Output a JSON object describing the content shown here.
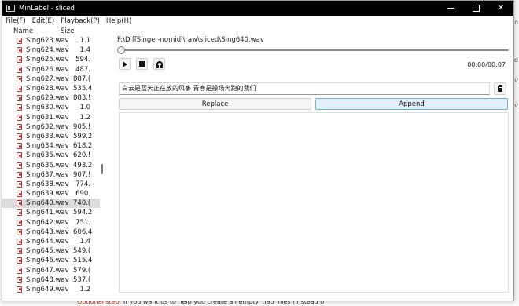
{
  "window": {
    "title": "MinLabel - sliced",
    "controls": [
      "minimize-icon",
      "maximize-icon",
      "close-icon"
    ]
  },
  "menu": [
    {
      "label": "File(F)"
    },
    {
      "label": "Edit(E)"
    },
    {
      "label": "Playback(P)"
    },
    {
      "label": "Help(H)"
    }
  ],
  "filelist": {
    "headers": {
      "name": "Name",
      "size": "Size"
    },
    "selected_index": 17,
    "rows": [
      {
        "name": "Sing623.wav",
        "size": "1.1"
      },
      {
        "name": "Sing624.wav",
        "size": "1.4"
      },
      {
        "name": "Sing625.wav",
        "size": "594."
      },
      {
        "name": "Sing626.wav",
        "size": "487."
      },
      {
        "name": "Sing627.wav",
        "size": "887.("
      },
      {
        "name": "Sing628.wav",
        "size": "535.4"
      },
      {
        "name": "Sing629.wav",
        "size": "883.!"
      },
      {
        "name": "Sing630.wav",
        "size": "1.0"
      },
      {
        "name": "Sing631.wav",
        "size": "1.2"
      },
      {
        "name": "Sing632.wav",
        "size": "905.!"
      },
      {
        "name": "Sing633.wav",
        "size": "599.2"
      },
      {
        "name": "Sing634.wav",
        "size": "618.2"
      },
      {
        "name": "Sing635.wav",
        "size": "620.!"
      },
      {
        "name": "Sing636.wav",
        "size": "493.2"
      },
      {
        "name": "Sing637.wav",
        "size": "907.!"
      },
      {
        "name": "Sing638.wav",
        "size": "774."
      },
      {
        "name": "Sing639.wav",
        "size": "690."
      },
      {
        "name": "Sing640.wav",
        "size": "740.("
      },
      {
        "name": "Sing641.wav",
        "size": "594.2"
      },
      {
        "name": "Sing642.wav",
        "size": "751."
      },
      {
        "name": "Sing643.wav",
        "size": "606.4"
      },
      {
        "name": "Sing644.wav",
        "size": "1.4"
      },
      {
        "name": "Sing645.wav",
        "size": "549.("
      },
      {
        "name": "Sing646.wav",
        "size": "515.4"
      },
      {
        "name": "Sing647.wav",
        "size": "579.("
      },
      {
        "name": "Sing648.wav",
        "size": "537.("
      },
      {
        "name": "Sing649.wav",
        "size": "1.2"
      }
    ]
  },
  "player": {
    "path": "F:\\DiffSinger-nomidi\\raw\\sliced\\Sing640.wav",
    "time": "00:00/00:07",
    "progress": 0,
    "buttons": [
      "play-icon",
      "stop-icon",
      "headphones-icon"
    ]
  },
  "lyrics": {
    "value": "白云是蓝天正在放的风筝 青春是操场奔跑的我们",
    "clipboard_icon": "clipboard-icon"
  },
  "actions": {
    "replace_label": "Replace",
    "append_label": "Append",
    "accent": "#6aaedb"
  },
  "background": {
    "bottom_red": "Optional step:",
    "bottom_rest": " If you want us to help you create all empty '.lab' files (instead o"
  }
}
